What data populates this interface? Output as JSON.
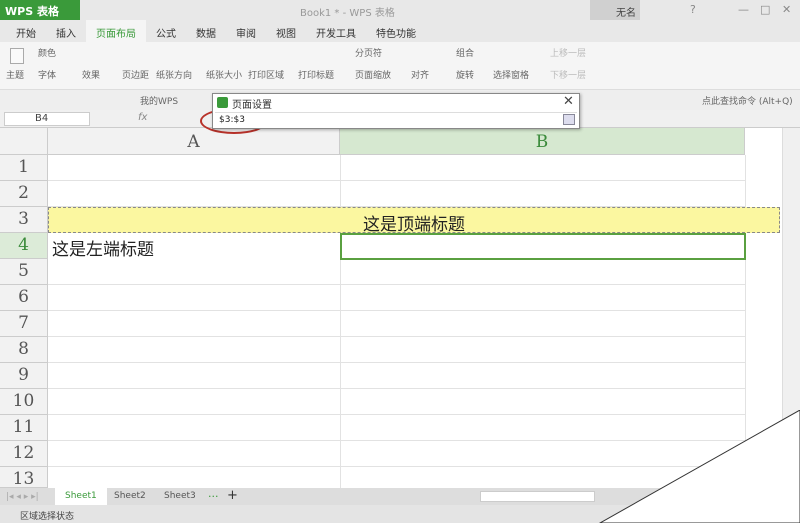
{
  "app": {
    "menu_button": "WPS 表格",
    "title": "Book1 * - WPS 表格",
    "user": "无名",
    "help": "?"
  },
  "menu": [
    "开始",
    "插入",
    "页面布局",
    "公式",
    "数据",
    "审阅",
    "视图",
    "开发工具",
    "特色功能"
  ],
  "ribbon": {
    "theme": "主题",
    "colors": "颜色",
    "fonts": "字体",
    "effects": "效果",
    "margins": "页边距",
    "orientation": "纸张方向",
    "size": "纸张大小",
    "print_area": "打印区域",
    "print_titles": "打印标题",
    "page_break": "分页符",
    "page_zoom": "页面缩放",
    "align": "对齐",
    "group": "组合",
    "rotate": "旋转",
    "selection_pane": "选择窗格",
    "bring_forward": "上移一层",
    "send_backward": "下移一层"
  },
  "quickbar": {
    "mywps": "我的WPS",
    "search": "点此查找命令 (Alt+Q)"
  },
  "formula": {
    "namebox": "B4",
    "fx": "fx"
  },
  "dialog": {
    "title": "页面设置",
    "value": "$3:$3"
  },
  "columns": [
    "A",
    "B"
  ],
  "rows": [
    "1",
    "2",
    "3",
    "4",
    "5",
    "6",
    "7",
    "8",
    "9",
    "10",
    "11",
    "12",
    "13"
  ],
  "cells": {
    "B3": "这是顶端标题",
    "A4": "这是左端标题"
  },
  "sheets": [
    "Sheet1",
    "Sheet2",
    "Sheet3"
  ],
  "status": "区域选择状态"
}
